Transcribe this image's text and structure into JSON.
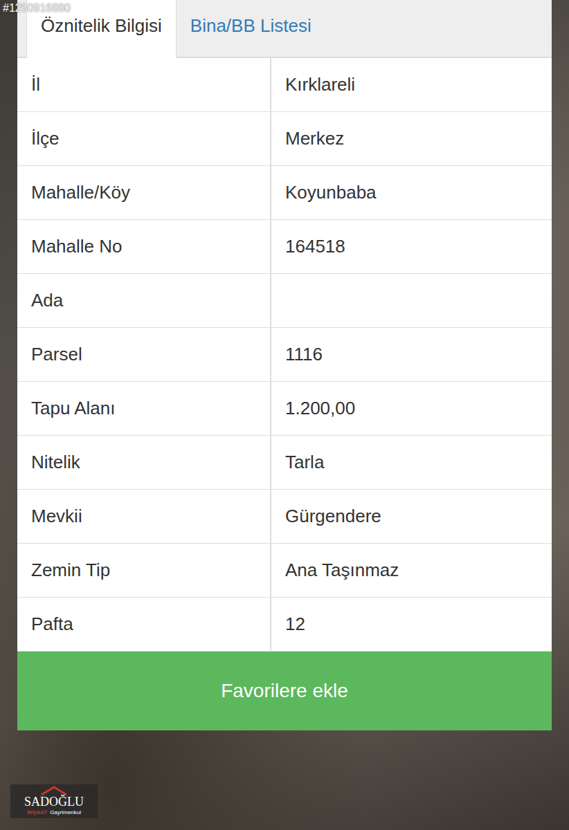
{
  "watermark": "#1250916880",
  "tabs": [
    {
      "label": "Öznitelik Bilgisi",
      "selected": true
    },
    {
      "label": "Bina/BB Listesi",
      "selected": false
    }
  ],
  "rows": [
    {
      "label": "İl",
      "value": "Kırklareli"
    },
    {
      "label": "İlçe",
      "value": "Merkez"
    },
    {
      "label": "Mahalle/Köy",
      "value": "Koyunbaba"
    },
    {
      "label": "Mahalle No",
      "value": "164518"
    },
    {
      "label": "Ada",
      "value": ""
    },
    {
      "label": "Parsel",
      "value": "1116"
    },
    {
      "label": "Tapu Alanı",
      "value": "1.200,00"
    },
    {
      "label": "Nitelik",
      "value": "Tarla"
    },
    {
      "label": "Mevkii",
      "value": "Gürgendere"
    },
    {
      "label": "Zemin Tip",
      "value": "Ana Taşınmaz"
    },
    {
      "label": "Pafta",
      "value": "12"
    }
  ],
  "button": "Favorilere ekle",
  "logo": {
    "name": "SADOĞLU",
    "line": "İNŞAAT",
    "sub": "Gayrimenkul"
  }
}
